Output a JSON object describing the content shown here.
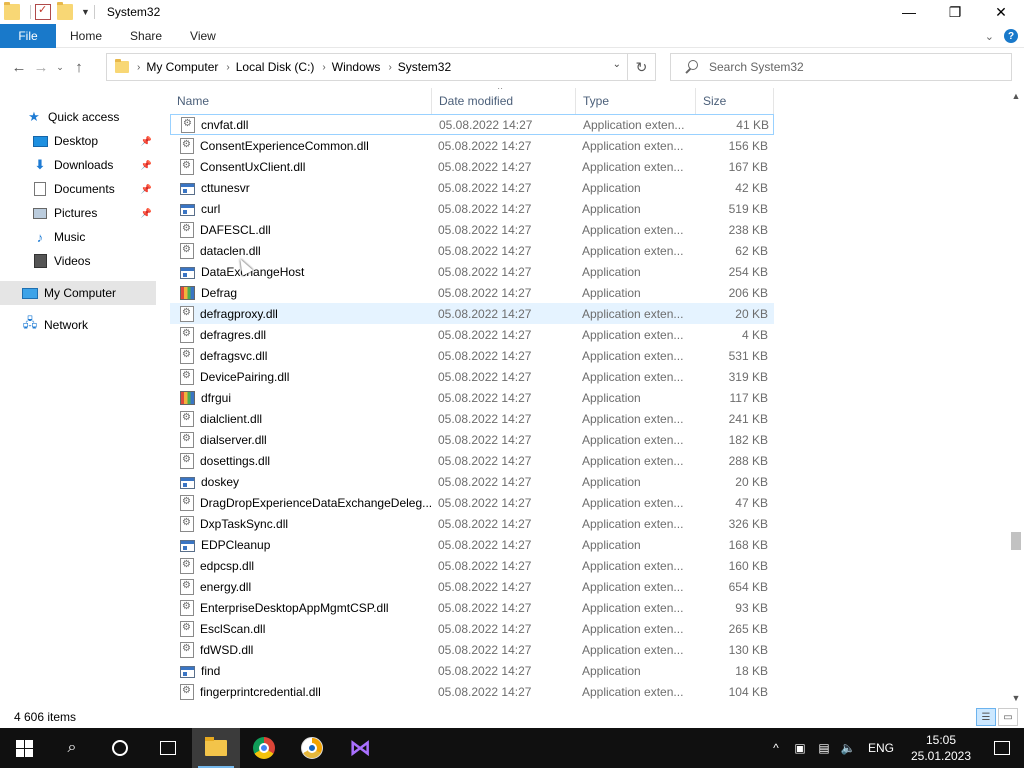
{
  "window": {
    "title": "System32"
  },
  "ribbon": {
    "tabs": [
      {
        "label": "File"
      },
      {
        "label": "Home"
      },
      {
        "label": "Share"
      },
      {
        "label": "View"
      }
    ]
  },
  "address": {
    "crumbs": [
      "My Computer",
      "Local Disk (C:)",
      "Windows",
      "System32"
    ]
  },
  "search": {
    "placeholder": "Search System32"
  },
  "navpane": {
    "items": [
      {
        "label": "Quick access",
        "icon": "star-icon",
        "pinned": false
      },
      {
        "label": "Desktop",
        "icon": "desktop-icon",
        "pinned": true
      },
      {
        "label": "Downloads",
        "icon": "download-icon",
        "pinned": true
      },
      {
        "label": "Documents",
        "icon": "document-icon",
        "pinned": true
      },
      {
        "label": "Pictures",
        "icon": "pictures-icon",
        "pinned": true
      },
      {
        "label": "Music",
        "icon": "music-icon",
        "pinned": false
      },
      {
        "label": "Videos",
        "icon": "videos-icon",
        "pinned": false
      },
      {
        "label": "My Computer",
        "icon": "computer-icon",
        "pinned": false,
        "selected": true
      },
      {
        "label": "Network",
        "icon": "network-icon",
        "pinned": false
      }
    ]
  },
  "columns": {
    "name": "Name",
    "date": "Date modified",
    "type": "Type",
    "size": "Size"
  },
  "files": [
    {
      "name": "cnvfat.dll",
      "date": "05.08.2022 14:27",
      "type": "Application exten...",
      "size": "41 KB",
      "kind": "dll"
    },
    {
      "name": "ConsentExperienceCommon.dll",
      "date": "05.08.2022 14:27",
      "type": "Application exten...",
      "size": "156 KB",
      "kind": "dll"
    },
    {
      "name": "ConsentUxClient.dll",
      "date": "05.08.2022 14:27",
      "type": "Application exten...",
      "size": "167 KB",
      "kind": "dll"
    },
    {
      "name": "cttunesvr",
      "date": "05.08.2022 14:27",
      "type": "Application",
      "size": "42 KB",
      "kind": "app"
    },
    {
      "name": "curl",
      "date": "05.08.2022 14:27",
      "type": "Application",
      "size": "519 KB",
      "kind": "app"
    },
    {
      "name": "DAFESCL.dll",
      "date": "05.08.2022 14:27",
      "type": "Application exten...",
      "size": "238 KB",
      "kind": "dll"
    },
    {
      "name": "dataclen.dll",
      "date": "05.08.2022 14:27",
      "type": "Application exten...",
      "size": "62 KB",
      "kind": "dll"
    },
    {
      "name": "DataExchangeHost",
      "date": "05.08.2022 14:27",
      "type": "Application",
      "size": "254 KB",
      "kind": "app"
    },
    {
      "name": "Defrag",
      "date": "05.08.2022 14:27",
      "type": "Application",
      "size": "206 KB",
      "kind": "defrag"
    },
    {
      "name": "defragproxy.dll",
      "date": "05.08.2022 14:27",
      "type": "Application exten...",
      "size": "20 KB",
      "kind": "dll"
    },
    {
      "name": "defragres.dll",
      "date": "05.08.2022 14:27",
      "type": "Application exten...",
      "size": "4 KB",
      "kind": "dll"
    },
    {
      "name": "defragsvc.dll",
      "date": "05.08.2022 14:27",
      "type": "Application exten...",
      "size": "531 KB",
      "kind": "dll"
    },
    {
      "name": "DevicePairing.dll",
      "date": "05.08.2022 14:27",
      "type": "Application exten...",
      "size": "319 KB",
      "kind": "dll"
    },
    {
      "name": "dfrgui",
      "date": "05.08.2022 14:27",
      "type": "Application",
      "size": "117 KB",
      "kind": "defrag"
    },
    {
      "name": "dialclient.dll",
      "date": "05.08.2022 14:27",
      "type": "Application exten...",
      "size": "241 KB",
      "kind": "dll"
    },
    {
      "name": "dialserver.dll",
      "date": "05.08.2022 14:27",
      "type": "Application exten...",
      "size": "182 KB",
      "kind": "dll"
    },
    {
      "name": "dosettings.dll",
      "date": "05.08.2022 14:27",
      "type": "Application exten...",
      "size": "288 KB",
      "kind": "dll"
    },
    {
      "name": "doskey",
      "date": "05.08.2022 14:27",
      "type": "Application",
      "size": "20 KB",
      "kind": "app"
    },
    {
      "name": "DragDropExperienceDataExchangeDeleg...",
      "date": "05.08.2022 14:27",
      "type": "Application exten...",
      "size": "47 KB",
      "kind": "dll"
    },
    {
      "name": "DxpTaskSync.dll",
      "date": "05.08.2022 14:27",
      "type": "Application exten...",
      "size": "326 KB",
      "kind": "dll"
    },
    {
      "name": "EDPCleanup",
      "date": "05.08.2022 14:27",
      "type": "Application",
      "size": "168 KB",
      "kind": "app"
    },
    {
      "name": "edpcsp.dll",
      "date": "05.08.2022 14:27",
      "type": "Application exten...",
      "size": "160 KB",
      "kind": "dll"
    },
    {
      "name": "energy.dll",
      "date": "05.08.2022 14:27",
      "type": "Application exten...",
      "size": "654 KB",
      "kind": "dll"
    },
    {
      "name": "EnterpriseDesktopAppMgmtCSP.dll",
      "date": "05.08.2022 14:27",
      "type": "Application exten...",
      "size": "93 KB",
      "kind": "dll"
    },
    {
      "name": "EsclScan.dll",
      "date": "05.08.2022 14:27",
      "type": "Application exten...",
      "size": "265 KB",
      "kind": "dll"
    },
    {
      "name": "fdWSD.dll",
      "date": "05.08.2022 14:27",
      "type": "Application exten...",
      "size": "130 KB",
      "kind": "dll"
    },
    {
      "name": "find",
      "date": "05.08.2022 14:27",
      "type": "Application",
      "size": "18 KB",
      "kind": "app"
    },
    {
      "name": "fingerprintcredential.dll",
      "date": "05.08.2022 14:27",
      "type": "Application exten...",
      "size": "104 KB",
      "kind": "dll"
    }
  ],
  "focused_row": 0,
  "hover_row": 9,
  "status": {
    "item_count": "4 606 items"
  },
  "taskbar": {
    "language": "ENG",
    "time": "15:05",
    "date": "25.01.2023"
  },
  "colors": {
    "file_tab": "#1979ca",
    "hover": "#e5f3ff",
    "focus_border": "#99d1ff",
    "taskbar": "#101010",
    "accent": "#76b9ed"
  }
}
